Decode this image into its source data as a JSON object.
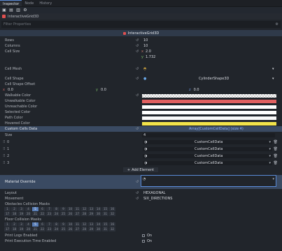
{
  "tabs": [
    "Inspector",
    "Node",
    "History"
  ],
  "object": {
    "name": "InteractiveGrid3D"
  },
  "filter": {
    "placeholder": "Filter Properties"
  },
  "section": {
    "title": "InteractiveGrid3D"
  },
  "props": {
    "rows": {
      "label": "Rows",
      "value": "10"
    },
    "columns": {
      "label": "Columns",
      "value": "10"
    },
    "cell_size": {
      "label": "Cell Size",
      "x_unit": "x",
      "x": "2.0",
      "y_unit": "y",
      "y": "1.732"
    },
    "cell_mesh": {
      "label": "Cell Mesh"
    },
    "cell_shape": {
      "label": "Cell Shape",
      "value": "CylinderShape3D"
    },
    "cell_shape_offset": {
      "label": "Cell Shape Offset",
      "x": "0.0",
      "y": "0.0",
      "z": "0.0",
      "xa": "x",
      "ya": "y",
      "za": "z"
    },
    "walkable_color": {
      "label": "Walkable Color"
    },
    "unwalkable_color": {
      "label": "Unwalkable Color"
    },
    "unreachable_color": {
      "label": "Unreachable Color"
    },
    "selected_color": {
      "label": "Selected Color"
    },
    "path_color": {
      "label": "Path Color"
    },
    "hovered_color": {
      "label": "Hovered Color"
    },
    "custom_cells_data": {
      "label": "Custom Cells Data",
      "value": "Array[CustomCellData] (size 4)"
    },
    "size": {
      "label": "Size",
      "value": "4"
    }
  },
  "items": [
    {
      "index": "0",
      "value": "CustomCellData"
    },
    {
      "index": "1",
      "value": "CustomCellData"
    },
    {
      "index": "2",
      "value": "CustomCellData"
    },
    {
      "index": "3",
      "value": "CustomCellData"
    }
  ],
  "add_element": "Add Element",
  "material_override": {
    "label": "Material Override"
  },
  "layout": {
    "label": "Layout",
    "value": "HEXAGONAL"
  },
  "movement": {
    "label": "Movement",
    "value": "SIX_DIRECTIONS"
  },
  "obstacles": {
    "label": "Obstacles Collision Masks",
    "row1": [
      "1",
      "2",
      "3",
      "4",
      "5",
      "6",
      "7",
      "8",
      "9",
      "10",
      "11",
      "12",
      "13",
      "14",
      "15",
      "16"
    ],
    "row2": [
      "17",
      "18",
      "19",
      "20",
      "21",
      "22",
      "23",
      "24",
      "25",
      "26",
      "27",
      "28",
      "29",
      "30",
      "31",
      "32"
    ],
    "on": [
      "5"
    ]
  },
  "floor": {
    "label": "Floor Collision Masks",
    "row1": [
      "1",
      "2",
      "3",
      "4",
      "5",
      "6",
      "7",
      "8",
      "9",
      "10",
      "11",
      "12",
      "13",
      "14",
      "15",
      "16"
    ],
    "row2": [
      "17",
      "18",
      "19",
      "20",
      "21",
      "22",
      "23",
      "24",
      "25",
      "26",
      "27",
      "28",
      "29",
      "30",
      "31",
      "32"
    ],
    "on": [
      "5"
    ]
  },
  "print_logs": {
    "label": "Print Logs Enabled",
    "value": "On"
  },
  "print_exec": {
    "label": "Print Execution Time Enabled",
    "value": "On"
  },
  "colors": {
    "unwalkable": "#e06060",
    "selected": "#ffffff",
    "path": "#fafafa",
    "hovered": "#f2e34a"
  }
}
